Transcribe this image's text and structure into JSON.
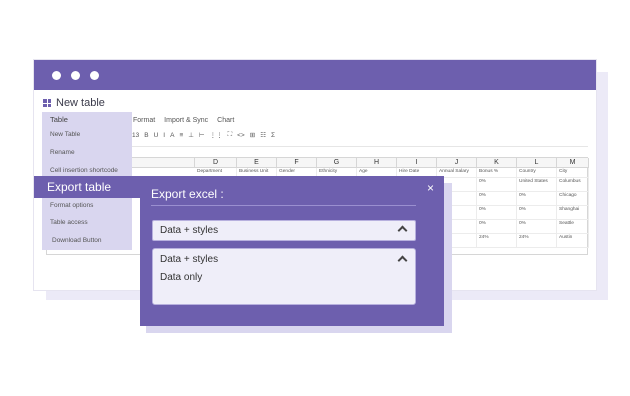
{
  "window": {
    "title": "New table"
  },
  "menubar": [
    "Format",
    "Import & Sync",
    "Chart"
  ],
  "toolbar": [
    "13",
    "B",
    "U",
    "I",
    "A",
    "≡",
    "⊥",
    "⊢",
    "⋮⋮",
    "⛶",
    "<>",
    "⊞",
    "☷",
    "Σ"
  ],
  "sheet": {
    "columns": [
      "D",
      "E",
      "F",
      "G",
      "H",
      "I",
      "J",
      "K",
      "L",
      "M"
    ],
    "header_row": [
      "Department",
      "Business Unit",
      "Gender",
      "Ethnicity",
      "Age",
      "Hire Date",
      "Annual Salary",
      "Bonus %",
      "Country",
      "City"
    ],
    "rows": [
      [
        "",
        "",
        "",
        "",
        "",
        "",
        "$",
        "0%",
        "United States",
        "Columbus"
      ],
      [
        "",
        "",
        "",
        "",
        "",
        "",
        "$",
        "0%",
        "0%",
        "Chicago"
      ],
      [
        "",
        "",
        "",
        "",
        "",
        "",
        "%",
        "0%",
        "0%",
        "Shanghai"
      ],
      [
        "",
        "",
        "",
        "",
        "",
        "",
        "2",
        "0%",
        "0%",
        "Seattle"
      ],
      [
        "",
        "",
        "",
        "",
        "",
        "",
        "00",
        "24%",
        "24%",
        "Austin"
      ]
    ],
    "left_fragments": [
      "...",
      "ulk",
      "Development"
    ]
  },
  "side_menu": {
    "title": "Table",
    "items": [
      "New Table",
      "Rename",
      "Cell insertion shortcode",
      "Format options",
      "Table access",
      "Download Button"
    ],
    "active_item": "Export table"
  },
  "dialog": {
    "title": "Export excel :",
    "close_label": "×",
    "selected_value": "Data + styles",
    "options": [
      "Data + styles",
      "Data only"
    ]
  },
  "colors": {
    "accent": "#6d5fae",
    "accent_light": "#d9d6ef",
    "option_bg": "#efeef9"
  }
}
